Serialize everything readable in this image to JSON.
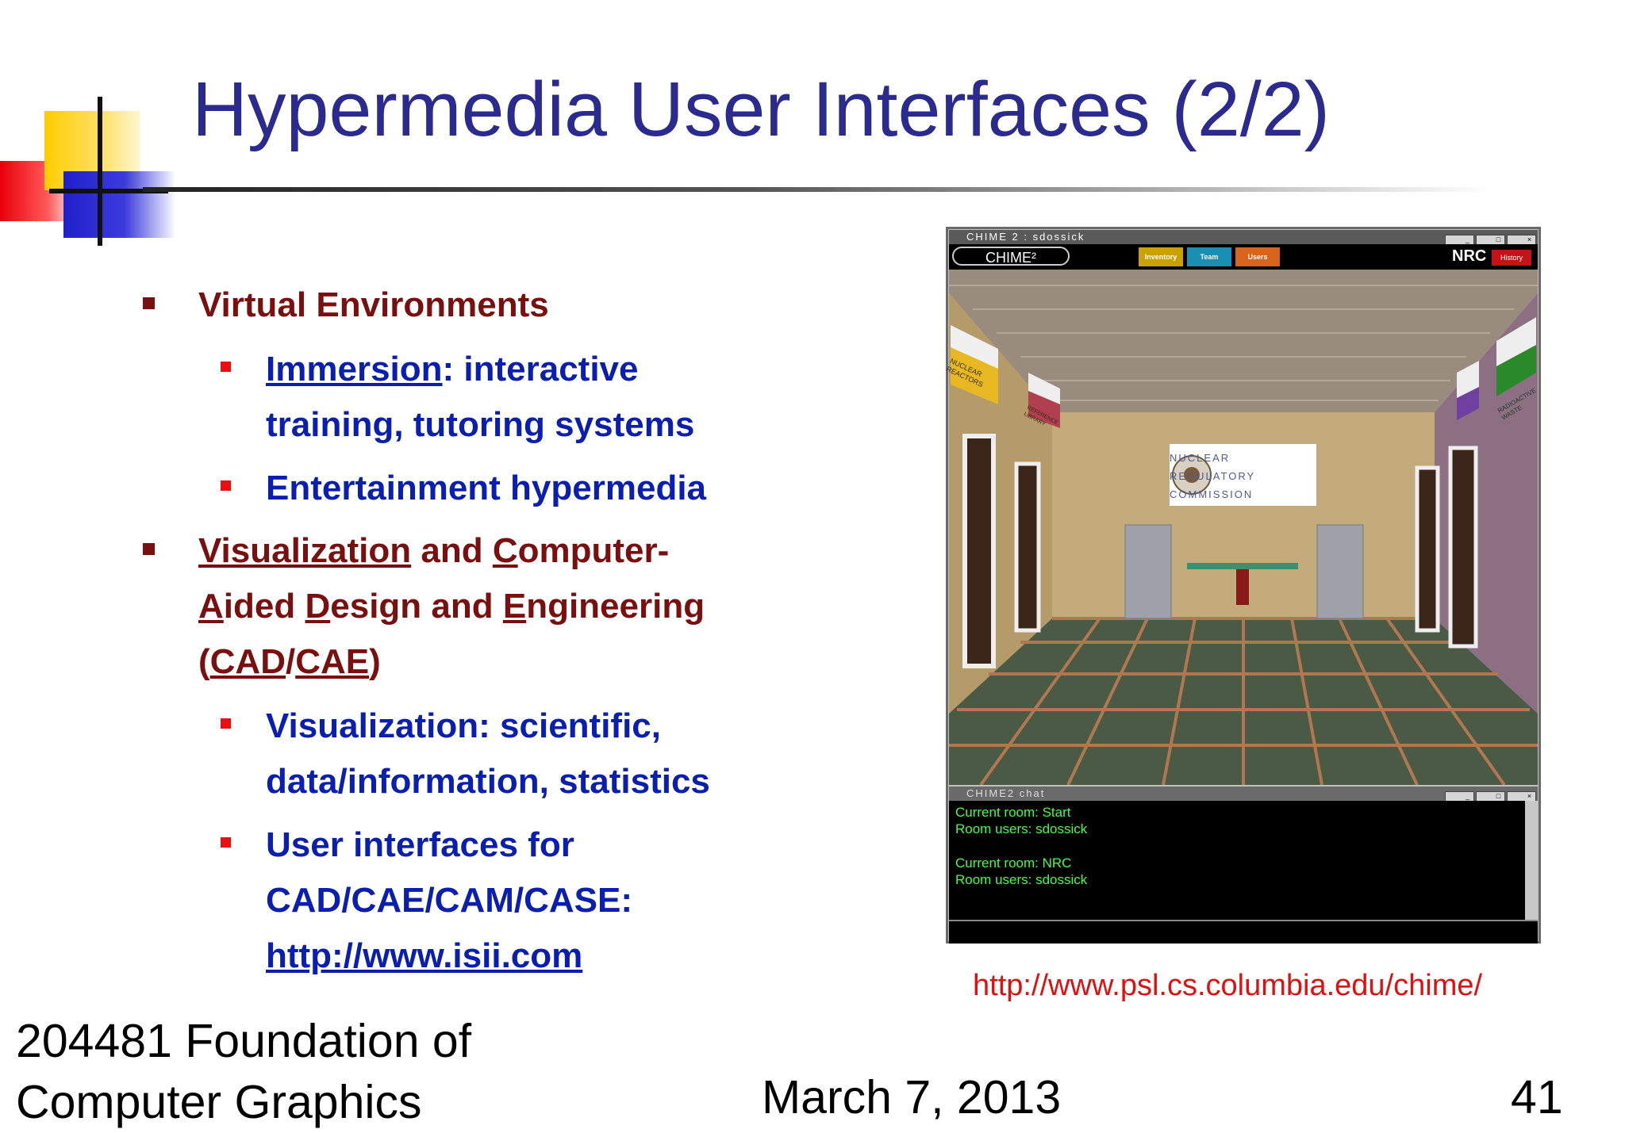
{
  "slide": {
    "title": "Hypermedia User Interfaces (2/2)",
    "bullets": {
      "virtual_env": "Virtual Environments",
      "immersion_link": "Immersion",
      "immersion_rest": ": interactive",
      "immersion_line2": "training, tutoring systems",
      "entertainment": "Entertainment hypermedia",
      "vis_link": "Visualization",
      "vis_and": " and ",
      "c_letter": "C",
      "computer_rest": "omputer-",
      "a_letter": "A",
      "aided_rest": "ided ",
      "d_letter": "D",
      "design_rest": "esign and ",
      "e_letter": "E",
      "engineering_rest": "ngineering",
      "paren_open": "(",
      "cad": "CAD",
      "slash": "/",
      "cae": "CAE",
      "paren_close": ")",
      "vis_sci_line1": "Visualization: scientific,",
      "vis_sci_line2": "data/information, statistics",
      "ui_line1": "User interfaces for",
      "ui_line2": "CAD/CAE/CAM/CASE:",
      "ui_url": "http://www.isii.com"
    },
    "screenshot": {
      "window_title": "CHIME 2 : sdossick",
      "logo": "CHIME²",
      "nav": [
        "Inventory",
        "Team",
        "Users"
      ],
      "nav_colors": [
        "#c9a100",
        "#1a8fb3",
        "#d8631a"
      ],
      "room": "NRC",
      "history": "History",
      "scene_signs": {
        "nuclear_reactors": "NUCLEAR REACTORS",
        "reference_library": "REFERENCE LIBRARY",
        "radioactive_waste": "RADIOACTIVE WASTE",
        "nrc_line1": "NUCLEAR",
        "nrc_line2": "REGULATORY",
        "nrc_line3": "COMMISSION"
      },
      "chat_title": "CHIME2 chat",
      "chat_lines": [
        "Current room: Start",
        "Room users: sdossick",
        "Current room: NRC",
        "Room users: sdossick"
      ]
    },
    "source_link": "http://www.psl.cs.columbia.edu/chime/",
    "footer": {
      "course_line1": "204481 Foundation of",
      "course_line2": "Computer Graphics",
      "date": "March 7, 2013",
      "page": "41"
    }
  }
}
